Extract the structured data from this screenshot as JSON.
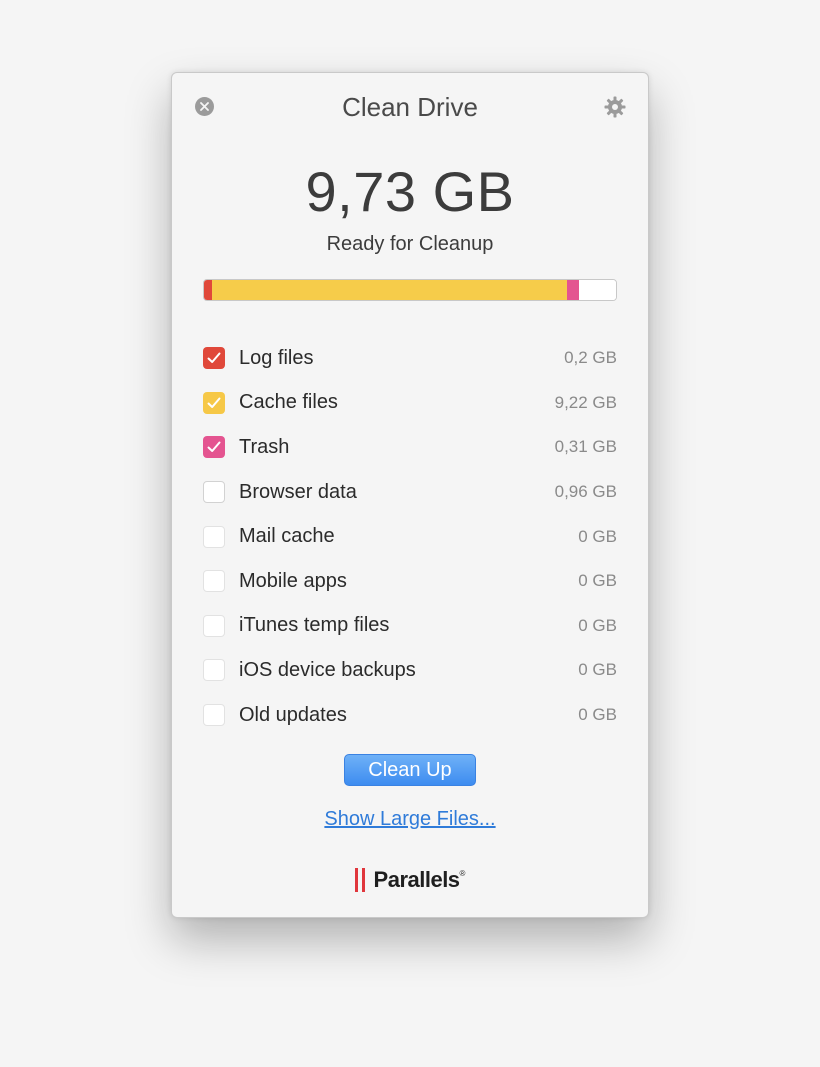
{
  "window": {
    "title": "Clean Drive",
    "close_icon": "close-icon",
    "settings_icon": "gear-icon"
  },
  "summary": {
    "total_size": "9,73 GB",
    "status_label": "Ready for Cleanup"
  },
  "usage_bar": {
    "segments": [
      {
        "name": "Log files",
        "value_gb": 0.2,
        "color": "#e0483a"
      },
      {
        "name": "Cache files",
        "value_gb": 9.22,
        "color": "#f6cc4a"
      },
      {
        "name": "Trash",
        "value_gb": 0.31,
        "color": "#e45490"
      },
      {
        "name": "Free",
        "value_gb": 0.96,
        "color": "#ffffff"
      }
    ]
  },
  "items": [
    {
      "label": "Log files",
      "size": "0,2 GB",
      "checked": true,
      "color": "#e0483a"
    },
    {
      "label": "Cache files",
      "size": "9,22 GB",
      "checked": true,
      "color": "#f6c847"
    },
    {
      "label": "Trash",
      "size": "0,31 GB",
      "checked": true,
      "color": "#e45490"
    },
    {
      "label": "Browser data",
      "size": "0,96 GB",
      "checked": false,
      "color": ""
    },
    {
      "label": "Mail cache",
      "size": "0 GB",
      "checked": false,
      "color": ""
    },
    {
      "label": "Mobile apps",
      "size": "0 GB",
      "checked": false,
      "color": ""
    },
    {
      "label": "iTunes temp files",
      "size": "0 GB",
      "checked": false,
      "color": ""
    },
    {
      "label": "iOS device backups",
      "size": "0 GB",
      "checked": false,
      "color": ""
    },
    {
      "label": "Old updates",
      "size": "0 GB",
      "checked": false,
      "color": ""
    }
  ],
  "actions": {
    "clean_up_label": "Clean Up",
    "show_large_files_label": "Show Large Files..."
  },
  "brand": {
    "name": "Parallels",
    "registered": "®",
    "bar_color": "#e0363c"
  }
}
